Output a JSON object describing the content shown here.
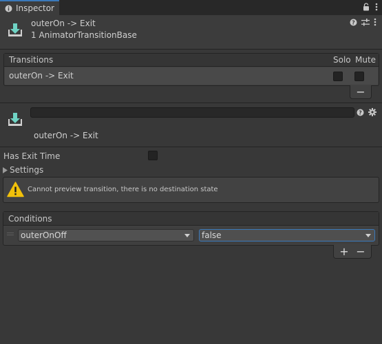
{
  "tab": {
    "label": "Inspector",
    "icon": "info-icon"
  },
  "header": {
    "title": "outerOn -> Exit",
    "subtitle": "1 AnimatorTransitionBase"
  },
  "transitions": {
    "title": "Transitions",
    "solo_label": "Solo",
    "mute_label": "Mute",
    "rows": [
      {
        "label": "outerOn -> Exit",
        "solo": false,
        "mute": false
      }
    ],
    "remove_label": "−"
  },
  "detail": {
    "name_value": "",
    "label": "outerOn -> Exit"
  },
  "fields": {
    "has_exit_time_label": "Has Exit Time",
    "has_exit_time": false,
    "settings_label": "Settings"
  },
  "help": {
    "text": "Cannot preview transition, there is no destination state"
  },
  "conditions": {
    "title": "Conditions",
    "rows": [
      {
        "parameter": "outerOnOff",
        "value": "false"
      }
    ],
    "add_label": "+",
    "remove_label": "−"
  },
  "colors": {
    "background": "#383838",
    "accent": "#3a79bb",
    "icon_teal": "#6fd3c4",
    "warning": "#f2c10a"
  }
}
